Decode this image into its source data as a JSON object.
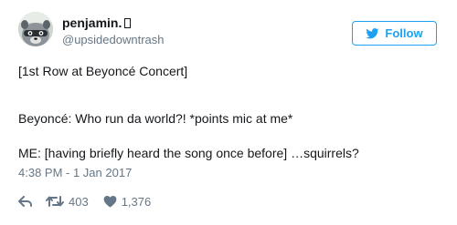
{
  "user": {
    "display_name": "penjamin.",
    "handle": "@upsidedowntrash"
  },
  "follow_button": {
    "label": "Follow",
    "icon": "twitter-bird-icon"
  },
  "tweet": {
    "lines": [
      "[1st Row at Beyoncé Concert]",
      "Beyoncé: Who run da world?! *points mic at me*",
      "ME: [having briefly heard the song once before] …squirrels?"
    ],
    "timestamp": "4:38 PM - 1 Jan 2017"
  },
  "actions": {
    "reply_icon": "reply-icon",
    "retweet_icon": "retweet-icon",
    "retweet_count": "403",
    "like_icon": "heart-icon",
    "like_count": "1,376"
  },
  "colors": {
    "accent": "#1da1f2",
    "text": "#14171a",
    "secondary": "#657786"
  }
}
